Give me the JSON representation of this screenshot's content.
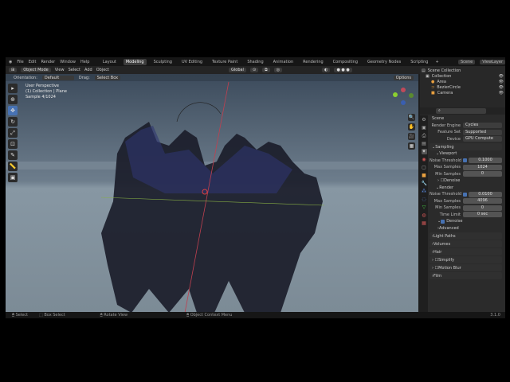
{
  "menu": [
    "File",
    "Edit",
    "Render",
    "Window",
    "Help"
  ],
  "workspaces": [
    "Layout",
    "Modeling",
    "Sculpting",
    "UV Editing",
    "Texture Paint",
    "Shading",
    "Animation",
    "Rendering",
    "Compositing",
    "Geometry Nodes",
    "Scripting"
  ],
  "active_workspace": "Modeling",
  "scene": "Scene",
  "view_layer": "ViewLayer",
  "header": {
    "mode": "Object Mode",
    "view": "View",
    "select": "Select",
    "add": "Add",
    "object": "Object",
    "transform": "Global",
    "options": "Options"
  },
  "subheader": {
    "orientation_label": "Orientation:",
    "orientation": "Default",
    "drag_label": "Drag:",
    "drag": "Select Box"
  },
  "viewport_info": {
    "line1": "User Perspective",
    "line2": "(1) Collection | Plane",
    "line3": "Sample 4/1024"
  },
  "outliner": {
    "root": "Scene Collection",
    "collection": "Collection",
    "items": [
      "Area",
      "BezierCircle",
      "Camera"
    ]
  },
  "properties": {
    "scene_title": "Scene",
    "render_engine_label": "Render Engine",
    "render_engine": "Cycles",
    "feature_set_label": "Feature Set",
    "feature_set": "Supported",
    "device_label": "Device",
    "device": "GPU Compute",
    "sampling": "Sampling",
    "viewport": "Viewport",
    "noise_threshold_label": "Noise Threshold",
    "vp_noise": "0.1000",
    "max_samples_label": "Max Samples",
    "vp_max": "1024",
    "min_samples_label": "Min Samples",
    "vp_min": "0",
    "denoise": "Denoise",
    "render": "Render",
    "r_noise": "0.0100",
    "r_max": "4096",
    "r_min": "0",
    "time_limit_label": "Time Limit",
    "time_limit": "0 sec",
    "advanced": "Advanced",
    "sections": [
      "Light Paths",
      "Volumes",
      "Hair",
      "Simplify",
      "Motion Blur",
      "Film"
    ]
  },
  "status": {
    "select": "Select",
    "box_select": "Box Select",
    "rotate": "Rotate View",
    "context": "Object Context Menu",
    "version": "3.1.0"
  }
}
